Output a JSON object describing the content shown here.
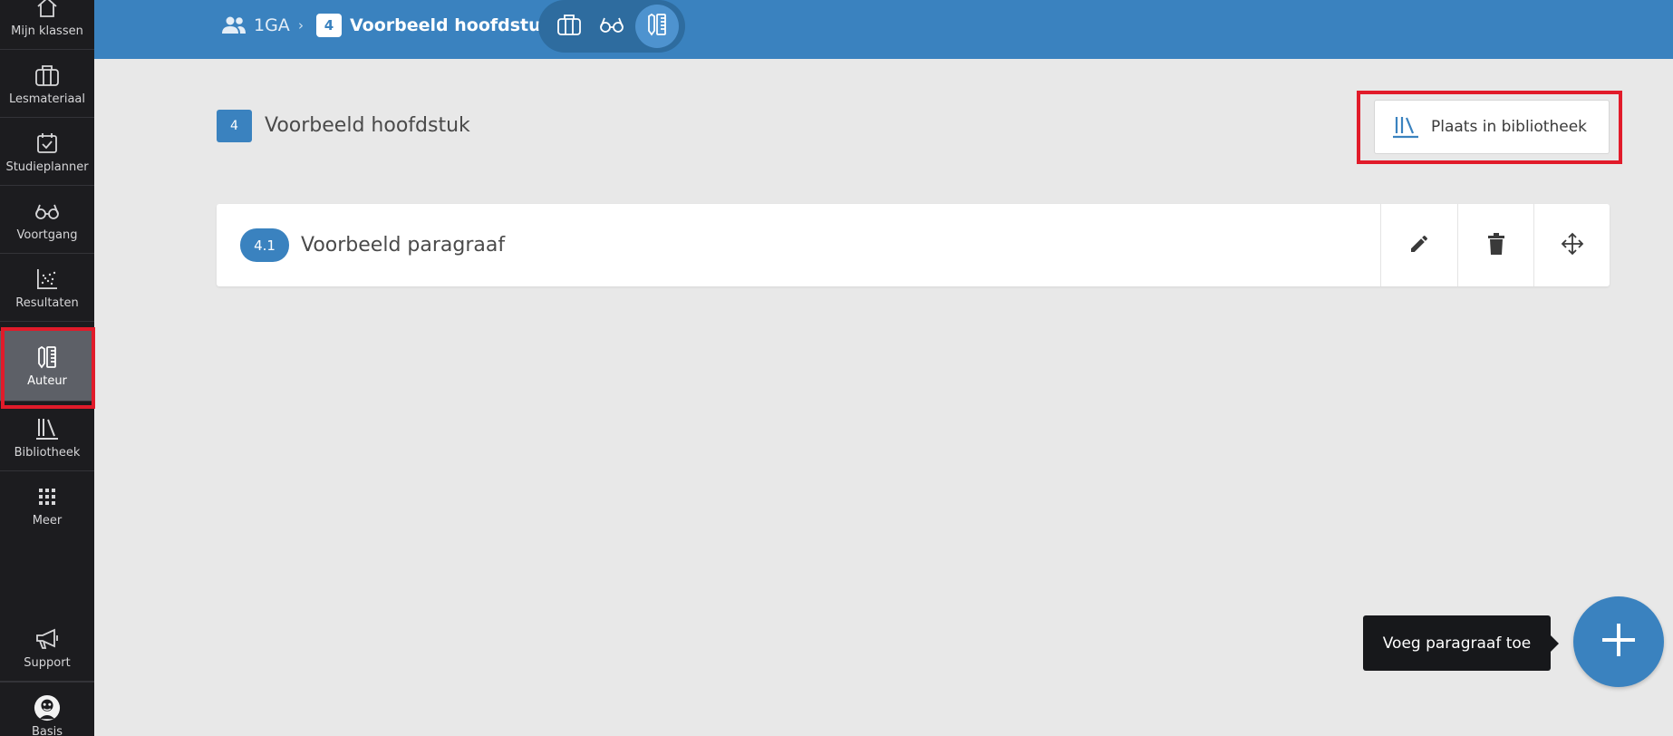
{
  "sidebar": {
    "items": [
      {
        "label": "Mijn klassen",
        "icon": "home-icon"
      },
      {
        "label": "Lesmateriaal",
        "icon": "briefcase-icon"
      },
      {
        "label": "Studieplanner",
        "icon": "calendar-check-icon"
      },
      {
        "label": "Voortgang",
        "icon": "glasses-icon"
      },
      {
        "label": "Resultaten",
        "icon": "scatter-chart-icon"
      },
      {
        "label": "Auteur",
        "icon": "author-pen-icon",
        "active": true
      },
      {
        "label": "Bibliotheek",
        "icon": "library-books-icon"
      },
      {
        "label": "Meer",
        "icon": "grid-dots-icon"
      }
    ],
    "bottom": [
      {
        "label": "Support",
        "icon": "megaphone-icon"
      },
      {
        "label": "Basis",
        "icon": "avatar-icon"
      }
    ]
  },
  "topbar": {
    "class_name": "1GA",
    "chapter_number": "4",
    "chapter_title": "Voorbeeld hoofdstuk",
    "modes": [
      "briefcase-icon",
      "glasses-icon",
      "author-pen-icon"
    ],
    "active_mode": "author-pen-icon"
  },
  "main": {
    "chapter_number": "4",
    "chapter_title": "Voorbeeld hoofdstuk",
    "library_button_label": "Plaats in bibliotheek",
    "paragraphs": [
      {
        "number": "4.1",
        "title": "Voorbeeld paragraaf"
      }
    ]
  },
  "fab": {
    "tooltip": "Voeg paragraaf toe"
  },
  "colors": {
    "accent": "#3a82bf",
    "sidebar_bg": "#1c1c1f",
    "sidebar_active": "#5d6067",
    "highlight": "#e11b2a",
    "tooltip_bg": "#17181b"
  }
}
